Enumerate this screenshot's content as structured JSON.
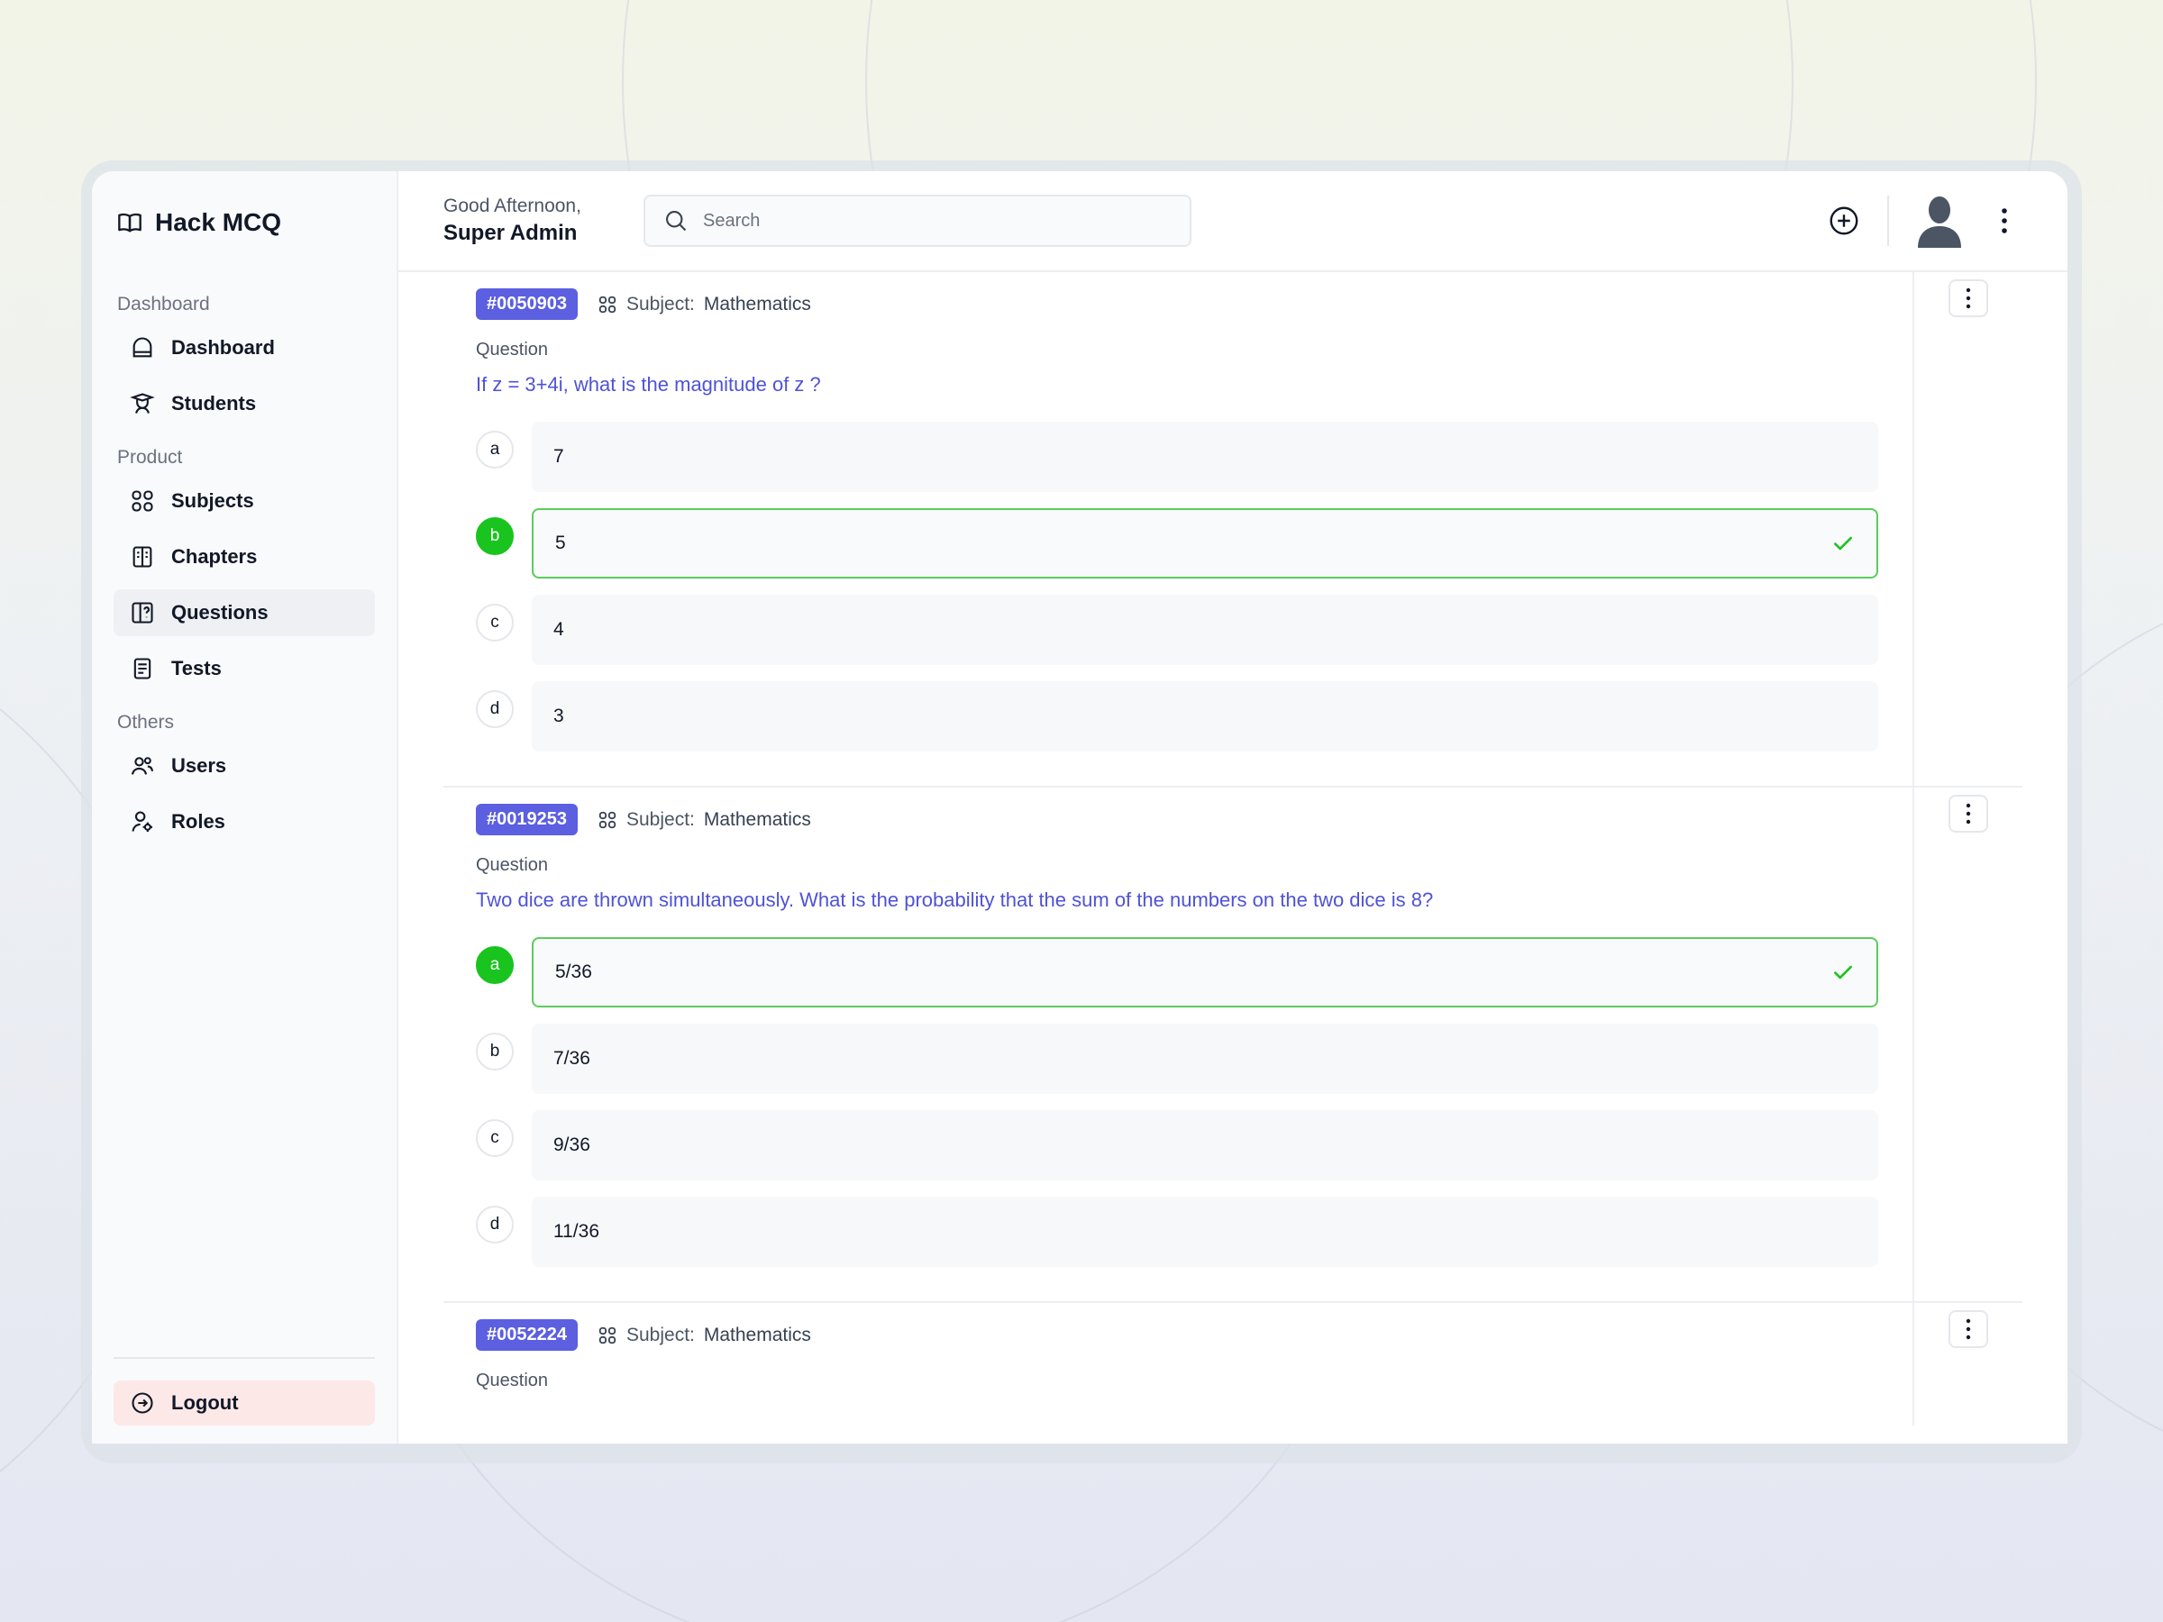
{
  "brand": {
    "title": "Hack MCQ"
  },
  "sidebar": {
    "sections": [
      {
        "label": "Dashboard",
        "items": [
          {
            "label": "Dashboard",
            "icon": "home-icon"
          },
          {
            "label": "Students",
            "icon": "student-icon"
          }
        ]
      },
      {
        "label": "Product",
        "items": [
          {
            "label": "Subjects",
            "icon": "grid-icon"
          },
          {
            "label": "Chapters",
            "icon": "book-icon"
          },
          {
            "label": "Questions",
            "icon": "questions-icon",
            "active": true
          },
          {
            "label": "Tests",
            "icon": "document-icon"
          }
        ]
      },
      {
        "label": "Others",
        "items": [
          {
            "label": "Users",
            "icon": "users-icon"
          },
          {
            "label": "Roles",
            "icon": "user-gear-icon"
          }
        ]
      }
    ],
    "logout_label": "Logout"
  },
  "header": {
    "greeting": "Good Afternoon,",
    "user_name": "Super Admin",
    "search_placeholder": "Search"
  },
  "questions": [
    {
      "id": "#0050903",
      "subject_prefix": "Subject:",
      "subject": "Mathematics",
      "question_label": "Question",
      "text": "If z = 3+4i, what is the magnitude of z ?",
      "options": [
        {
          "letter": "a",
          "text": "7",
          "correct": false
        },
        {
          "letter": "b",
          "text": "5",
          "correct": true
        },
        {
          "letter": "c",
          "text": "4",
          "correct": false
        },
        {
          "letter": "d",
          "text": "3",
          "correct": false
        }
      ]
    },
    {
      "id": "#0019253",
      "subject_prefix": "Subject:",
      "subject": "Mathematics",
      "question_label": "Question",
      "text": "Two dice are thrown simultaneously. What is the probability that the sum of the numbers on the two dice is 8?",
      "options": [
        {
          "letter": "a",
          "text": "5/36",
          "correct": true
        },
        {
          "letter": "b",
          "text": "7/36",
          "correct": false
        },
        {
          "letter": "c",
          "text": "9/36",
          "correct": false
        },
        {
          "letter": "d",
          "text": "11/36",
          "correct": false
        }
      ]
    },
    {
      "id": "#0052224",
      "subject_prefix": "Subject:",
      "subject": "Mathematics",
      "question_label": "Question",
      "text": "",
      "options": []
    }
  ],
  "colors": {
    "accent": "#5b5fe0",
    "question_text": "#4f52d6",
    "correct": "#19c41f",
    "logout_bg": "#fde8e8"
  }
}
